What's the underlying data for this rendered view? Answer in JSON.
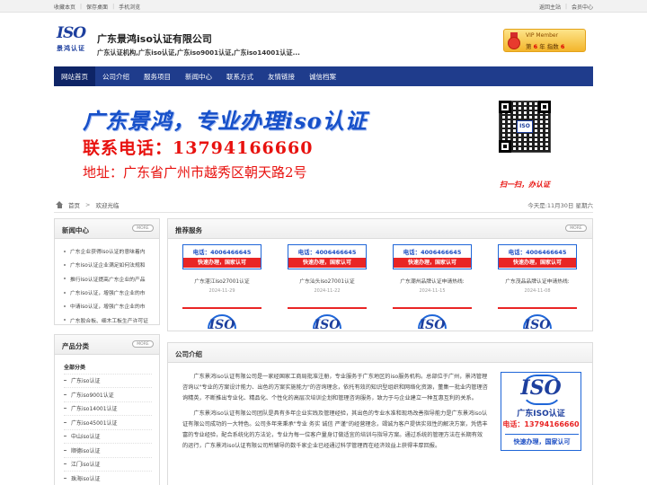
{
  "topbar": {
    "left_links": [
      "收藏本页",
      "保存桌面",
      "手机浏览"
    ],
    "right_links": [
      "返回主站",
      "会员中心"
    ]
  },
  "header": {
    "logo_text": "ISO",
    "logo_sub": "景鸿认证",
    "company_name": "广东景鸿iso认证有限公司",
    "tagline": "广东认证机构,广东iso认证,广东iso9001认证,广东iso14001认证...",
    "vip": {
      "title": "VIP Member",
      "rank_prefix": "第",
      "years": "6",
      "rank_mid": "年  指数",
      "index": "6"
    }
  },
  "nav": {
    "items": [
      "网站首页",
      "公司介绍",
      "服务项目",
      "新闻中心",
      "联系方式",
      "友情链接",
      "诚信档案"
    ],
    "active_index": 0
  },
  "banner": {
    "title": "广东景鸿，专业办理iso认证",
    "phone": "联系电话：13794166660",
    "address": "地址：广东省广州市越秀区朝天路2号",
    "qr_logo": "ISO",
    "qr_caption": "扫一扫，办认证"
  },
  "breadcrumb": {
    "home": "首页",
    "current": "欢迎光临",
    "date": "今天是:11月30日 星期六"
  },
  "news": {
    "title": "新闻中心",
    "more": "MORE",
    "items": [
      "广东企业获得iso认证的意味着内",
      "广东iso认证企业满足如何法规和",
      "推行iso认证提高广东企业的产品",
      "广东iso认证，增强广东企业的市",
      "中请iso认证，增强广东企业的市",
      "广东胶合板、细木工板生产许可证"
    ]
  },
  "categories": {
    "title": "产品分类",
    "more": "MORE",
    "items": [
      "全部分类",
      "广东iso认证",
      "广东iso9001认证",
      "广东iso14001认证",
      "广东iso45001认证",
      "中山iso认证",
      "顺德iso认证",
      "江门iso认证",
      "珠海iso认证"
    ]
  },
  "services": {
    "title": "推荐服务",
    "more": "MORE",
    "card_tel": "电话：4006466645",
    "card_fast": "快速办理，国家认可",
    "cards": [
      {
        "name": "广东湛江iso27001认证",
        "date": "2024-11-29"
      },
      {
        "name": "广东汕头iso27001认证",
        "date": "2024-11-22"
      },
      {
        "name": "广东潮州品牌认证申请热线:",
        "date": "2024-11-15"
      },
      {
        "name": "广东茂品品牌认证申请热线:",
        "date": "2024-11-08"
      }
    ],
    "mini_iso": "ISO"
  },
  "about": {
    "title": "公司介绍",
    "paragraphs": [
      "广东景鸿iso认证有限公司是一家经国家工商局批准注册，专业服务于广东地区的iso服务机构。总部位于广州，景鸿管理咨询以\"专业的方案设计能力、出色的方案实施能力\"的咨询理念，依托有效的知识型组织和网络化资源，董集一批业内管理咨询精英，不断推出专业化、精品化、个性化的高层次培训企划和管理咨询服务，致力于与企业建立一种互惠互利的关系。",
      "广东景鸿iso认证有限公司团队是具有多年企业实践及管理经验，其出色的专业水准和现场改善指导能力是广东景鸿iso认证有限公司成功的一大特色。公司多年来秉承\"专业 务实 诚信 严谨\"的经营理念，竭诚为客户提供实效性的解决方案，凭借丰富的专业经验，配合系统化的方法论，专业为每一位客户量身订做适宜的培训与指导方案。通过系统的管理方法在长期有效的运行，广东景鸿iso认证有限公司所辅导的数千家企业已经通过科学管理而在经济效益上获得丰厚回报。"
    ],
    "img_iso": "ISO",
    "img_cn": "广东ISO认证",
    "img_phone": "电话：13794166660",
    "img_fast": "快速办理，国家认可"
  }
}
